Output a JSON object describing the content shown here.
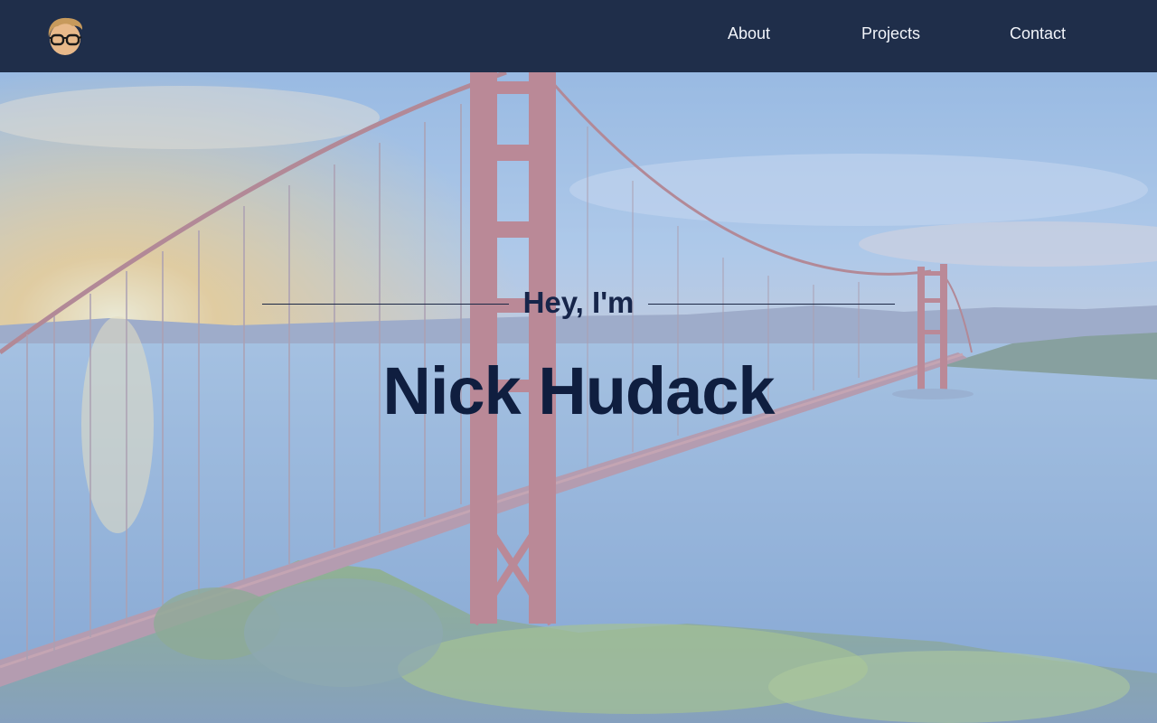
{
  "nav": {
    "logo_icon": "cartoon-avatar-with-glasses-icon",
    "links": [
      {
        "label": "About"
      },
      {
        "label": "Projects"
      },
      {
        "label": "Contact"
      }
    ]
  },
  "hero": {
    "greeting": "Hey, I'm",
    "name": "Nick Hudack",
    "background": "golden-gate-bridge-photo"
  },
  "colors": {
    "navbar_bg": "#1f2e4a",
    "nav_text": "#f1f4fa",
    "heading_text": "#0f1e3f"
  }
}
